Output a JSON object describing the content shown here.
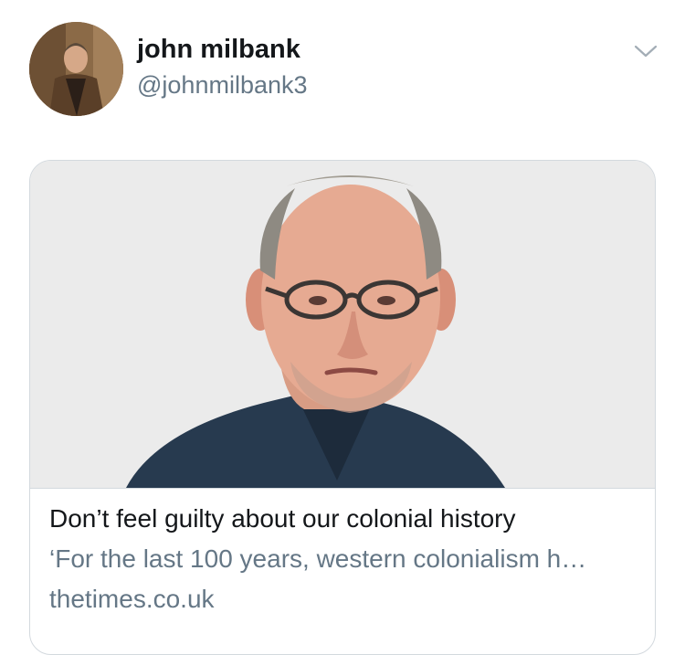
{
  "tweet": {
    "author": {
      "display_name": "john milbank",
      "handle": "@johnmilbank3",
      "avatar_icon": "profile-photo"
    },
    "menu_icon": "chevron-down-icon"
  },
  "link_card": {
    "image_icon": "article-author-photo",
    "title": "Don’t feel guilty about our colonial history",
    "description": "‘For the last 100 years, western colonialism h…",
    "domain": "thetimes.co.uk"
  },
  "colors": {
    "text_primary": "#14171a",
    "text_secondary": "#657786",
    "border": "#d3d9de",
    "image_background": "#ebebeb"
  }
}
